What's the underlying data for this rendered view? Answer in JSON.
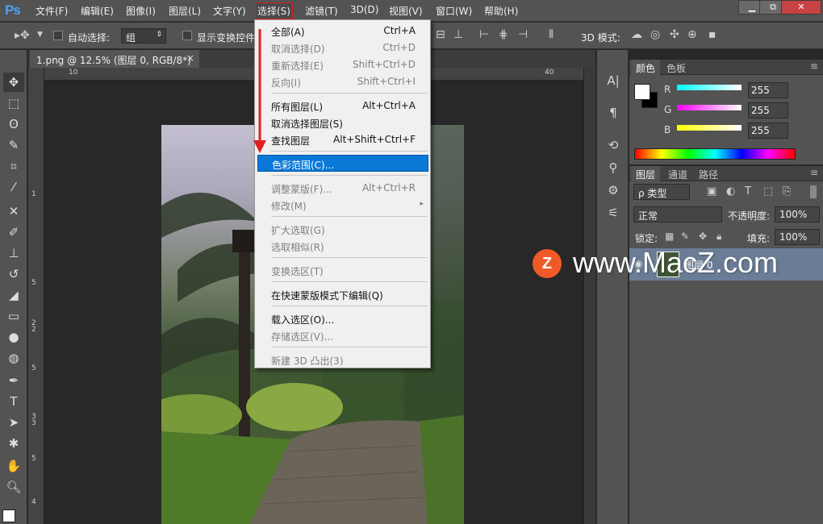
{
  "app": {
    "logo": "Ps"
  },
  "menubar": {
    "items": [
      "文件(F)",
      "编辑(E)",
      "图像(I)",
      "图层(L)",
      "文字(Y)",
      "选择(S)",
      "滤镜(T)",
      "3D(D)",
      "视图(V)",
      "窗口(W)",
      "帮助(H)"
    ],
    "active_index": 5
  },
  "window_controls": {
    "minimize": "▁",
    "restore": "⧉",
    "close": "✕"
  },
  "options_bar": {
    "auto_select_label": "自动选择:",
    "auto_select_value": "组",
    "show_transform_label": "显示变换控件",
    "mode3d_label": "3D 模式:"
  },
  "document": {
    "tab_title": "1.png @ 12.5% (图层 0, RGB/8*)",
    "close_glyph": "×",
    "ruler_h": [
      "10",
      "40"
    ],
    "ruler_v": [
      "1",
      "5",
      "2",
      "2",
      "5",
      "3",
      "3",
      "5",
      "4"
    ]
  },
  "select_menu": {
    "items": [
      {
        "label": "全部(A)",
        "shortcut": "Ctrl+A",
        "disabled": false
      },
      {
        "label": "取消选择(D)",
        "shortcut": "Ctrl+D",
        "disabled": true
      },
      {
        "label": "重新选择(E)",
        "shortcut": "Shift+Ctrl+D",
        "disabled": true
      },
      {
        "label": "反向(I)",
        "shortcut": "Shift+Ctrl+I",
        "disabled": true
      },
      {
        "label": "所有图层(L)",
        "shortcut": "Alt+Ctrl+A",
        "disabled": false
      },
      {
        "label": "取消选择图层(S)",
        "shortcut": "",
        "disabled": false
      },
      {
        "label": "查找图层",
        "shortcut": "Alt+Shift+Ctrl+F",
        "disabled": false
      },
      {
        "label": "色彩范围(C)...",
        "shortcut": "",
        "disabled": false,
        "highlighted": true
      },
      {
        "label": "调整蒙版(F)...",
        "shortcut": "Alt+Ctrl+R",
        "disabled": true
      },
      {
        "label": "修改(M)",
        "shortcut": "",
        "disabled": true,
        "submenu": true
      },
      {
        "label": "扩大选取(G)",
        "shortcut": "",
        "disabled": true
      },
      {
        "label": "选取相似(R)",
        "shortcut": "",
        "disabled": true
      },
      {
        "label": "变换选区(T)",
        "shortcut": "",
        "disabled": true
      },
      {
        "label": "在快速蒙版模式下编辑(Q)",
        "shortcut": "",
        "disabled": false
      },
      {
        "label": "载入选区(O)...",
        "shortcut": "",
        "disabled": false
      },
      {
        "label": "存储选区(V)...",
        "shortcut": "",
        "disabled": true
      },
      {
        "label": "新建 3D 凸出(3)",
        "shortcut": "",
        "disabled": true
      }
    ],
    "submenu_glyph": "▸"
  },
  "color_panel": {
    "tabs": [
      "颜色",
      "色板"
    ],
    "channels": [
      {
        "name": "R",
        "value": "255"
      },
      {
        "name": "G",
        "value": "255"
      },
      {
        "name": "B",
        "value": "255"
      }
    ]
  },
  "layers_panel": {
    "tabs": [
      "图层",
      "通道",
      "路径"
    ],
    "filter_label": "ρ 类型",
    "blend_mode": "正常",
    "opacity_label": "不透明度:",
    "opacity_value": "100%",
    "lock_label": "锁定:",
    "fill_label": "填充:",
    "fill_value": "100%",
    "layer_name": "图层 0"
  },
  "watermark": {
    "badge": "Z",
    "text": "www.MacZ.com"
  },
  "colors": {
    "accent": "#0a78d7",
    "annotation_red": "#e02020",
    "ui_gray": "#535353"
  }
}
